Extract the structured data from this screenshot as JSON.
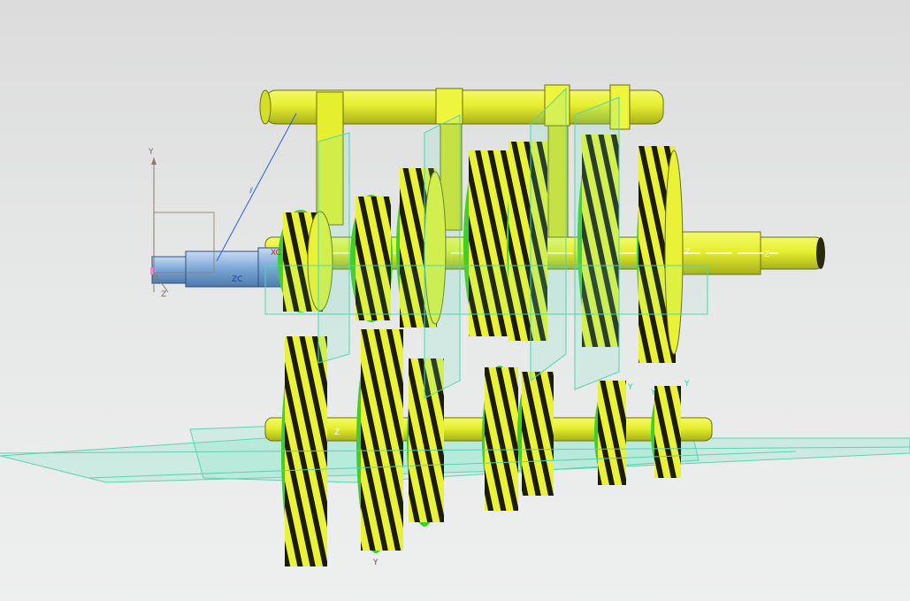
{
  "viewport": {
    "background_top": "#dcdcdc",
    "background_bottom": "#eeefef"
  },
  "colors": {
    "gear_body": "#e9f236",
    "gear_body_dark": "#b8c21e",
    "gear_tooth_dark": "#1c1c08",
    "gear_rim": "#39d12a",
    "shaft": "#e6ef2e",
    "shaft_dark": "#9aa317",
    "datum_plane": "#6fe6c4",
    "selected_shaft": "#7aa6d6",
    "triad_axis": "#8a7a6a",
    "axis_line": "#2a5fe0"
  },
  "labels": {
    "wcs_y": "Y",
    "wcs_z": "Z",
    "zc": "ZC",
    "xc": "XC",
    "axis_z_top": "Z",
    "axis_z_right": "Z",
    "axis_y_bottom": "Y",
    "axis_y_gear_1": "Y",
    "axis_y_gear_2": "Y",
    "axis_y_gear_3": "Y",
    "axis_z_bottom": "Z"
  },
  "icons": {
    "csys": "coordinate-system-icon",
    "dimension": "dimension-symbol-icon"
  }
}
